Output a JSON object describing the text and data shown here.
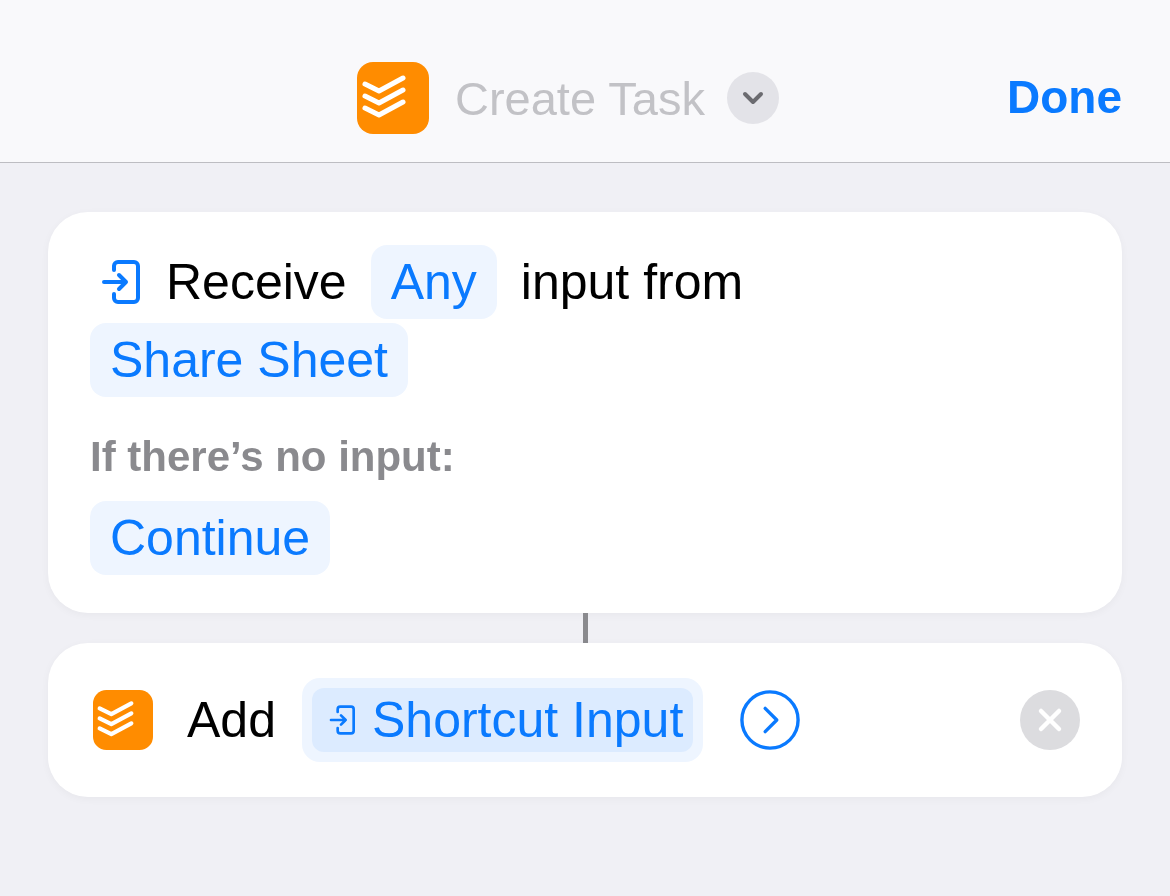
{
  "header": {
    "title": "Create Task",
    "done": "Done"
  },
  "receive": {
    "label": "Receive",
    "type": "Any",
    "middle": "input from",
    "source": "Share Sheet",
    "no_input_label": "If there’s no input:",
    "no_input_action": "Continue"
  },
  "add": {
    "verb": "Add",
    "variable": "Shortcut Input"
  }
}
